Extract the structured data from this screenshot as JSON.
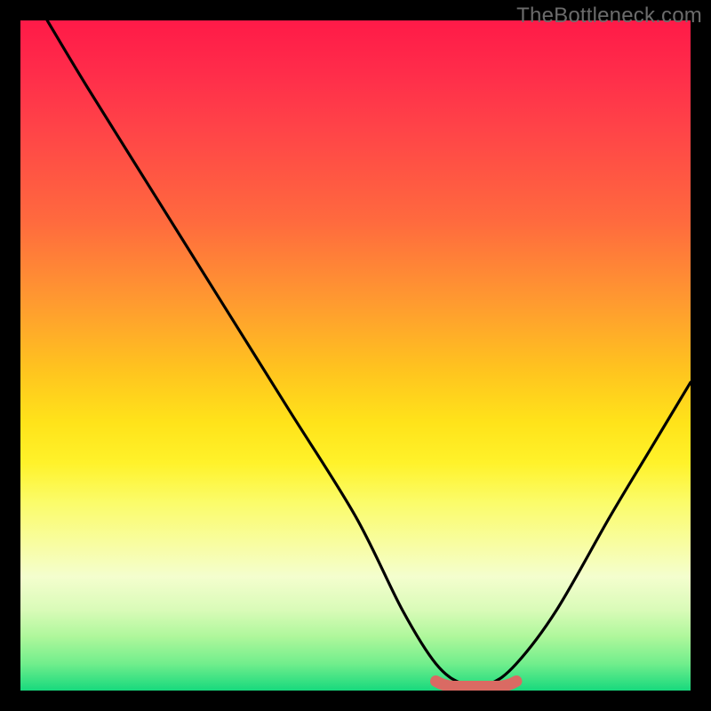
{
  "watermark": {
    "text": "TheBottleneck.com"
  },
  "chart_data": {
    "type": "line",
    "title": "",
    "xlabel": "",
    "ylabel": "",
    "xlim": [
      0,
      100
    ],
    "ylim": [
      0,
      100
    ],
    "series": [
      {
        "name": "bottleneck-curve",
        "x": [
          4,
          10,
          20,
          30,
          40,
          50,
          57,
          62,
          66,
          70,
          74,
          80,
          88,
          94,
          100
        ],
        "y": [
          100,
          90,
          74,
          58,
          42,
          26,
          12,
          4,
          1,
          1,
          4,
          12,
          26,
          36,
          46
        ]
      }
    ],
    "marker": {
      "name": "optimal-range",
      "color": "#da6a63",
      "x_start": 62,
      "x_end": 74,
      "y": 1
    },
    "gradient_stops": [
      {
        "pos": 0,
        "color": "#ff1a48"
      },
      {
        "pos": 50,
        "color": "#ffc31f"
      },
      {
        "pos": 78,
        "color": "#f8fda0"
      },
      {
        "pos": 100,
        "color": "#17d97d"
      }
    ]
  }
}
